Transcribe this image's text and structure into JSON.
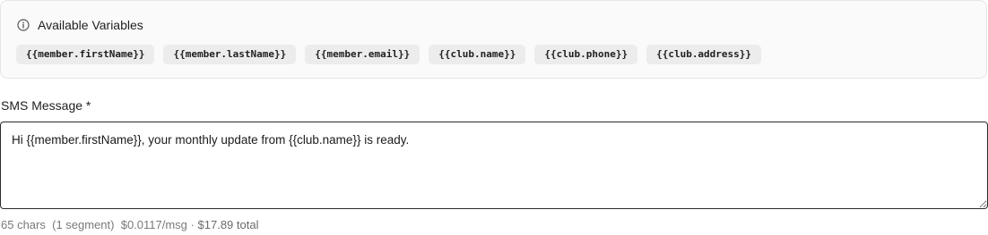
{
  "variables_panel": {
    "title": "Available Variables",
    "icon": "info-icon",
    "chips": [
      "{{member.firstName}}",
      "{{member.lastName}}",
      "{{member.email}}",
      "{{club.name}}",
      "{{club.phone}}",
      "{{club.address}}"
    ]
  },
  "sms_field": {
    "label": "SMS Message *",
    "value": "Hi {{member.firstName}}, your monthly update from {{club.name}} is ready."
  },
  "stats": {
    "chars": "65 chars",
    "segments": "(1 segment)",
    "per_msg": "$0.0117/msg",
    "separator": "·",
    "total": "$17.89 total"
  }
}
